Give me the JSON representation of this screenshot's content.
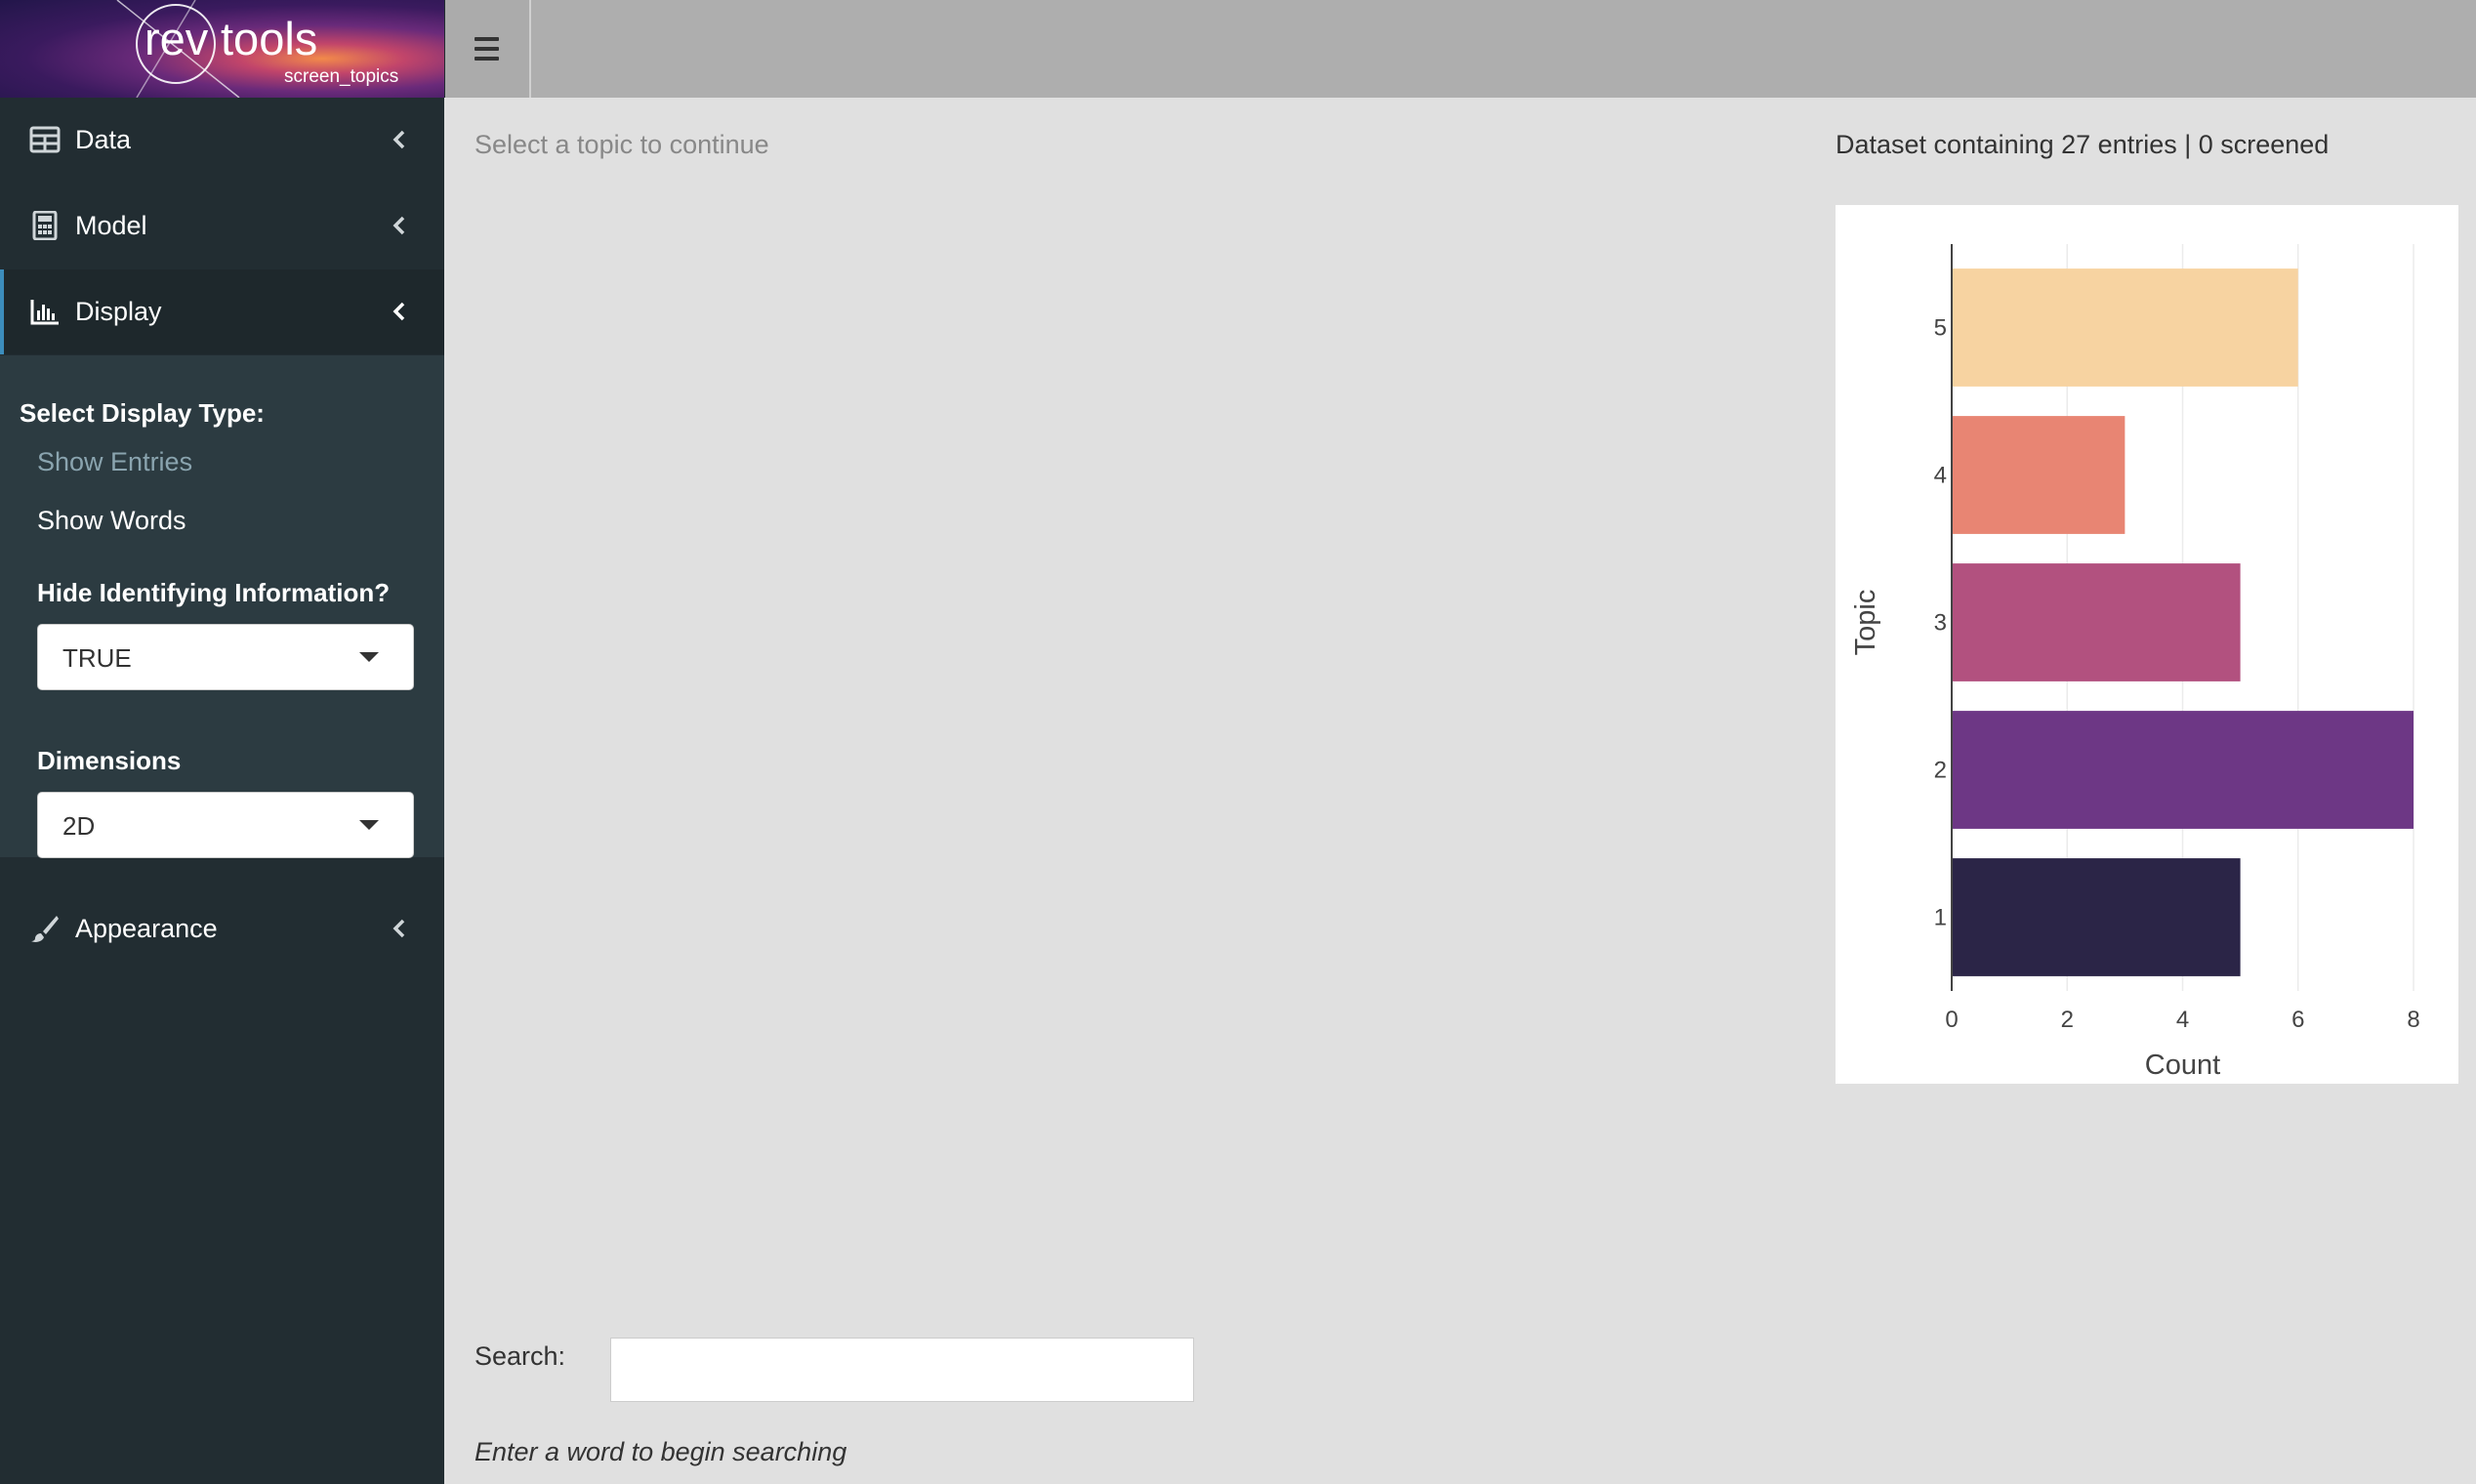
{
  "logo": {
    "rev": "rev",
    "tools": "tools",
    "subtitle": "screen_topics"
  },
  "sidebar": {
    "items": [
      {
        "label": "Data",
        "icon": "table-icon"
      },
      {
        "label": "Model",
        "icon": "calculator-icon"
      },
      {
        "label": "Display",
        "icon": "bar-chart-icon"
      },
      {
        "label": "Appearance",
        "icon": "paintbrush-icon"
      }
    ],
    "display_panel": {
      "display_type_heading": "Select Display Type:",
      "options": [
        "Show Entries",
        "Show Words"
      ],
      "hide_heading": "Hide Identifying Information?",
      "hide_value": "TRUE",
      "dimensions_heading": "Dimensions",
      "dimensions_value": "2D"
    }
  },
  "main": {
    "prompt": "Select a topic to continue",
    "dataset_info": "Dataset containing 27 entries | 0 screened",
    "search_label": "Search:",
    "search_value": "",
    "search_help": "Enter a word to begin searching"
  },
  "colors": {
    "sidebar_bg": "#222d32",
    "topbar_bg": "#aeaeae",
    "accent": "#3c8dbc"
  },
  "chart_data": {
    "type": "bar",
    "orientation": "horizontal",
    "categories": [
      "1",
      "2",
      "3",
      "4",
      "5"
    ],
    "values": [
      5,
      8,
      5,
      3,
      6
    ],
    "colors": [
      "#2b2547",
      "#6d3785",
      "#b2517f",
      "#e88573",
      "#f7d3a1"
    ],
    "xlabel": "Count",
    "ylabel": "Topic",
    "xlim": [
      0,
      8
    ],
    "xticks": [
      "0",
      "2",
      "4",
      "6",
      "8"
    ],
    "grid": true
  }
}
